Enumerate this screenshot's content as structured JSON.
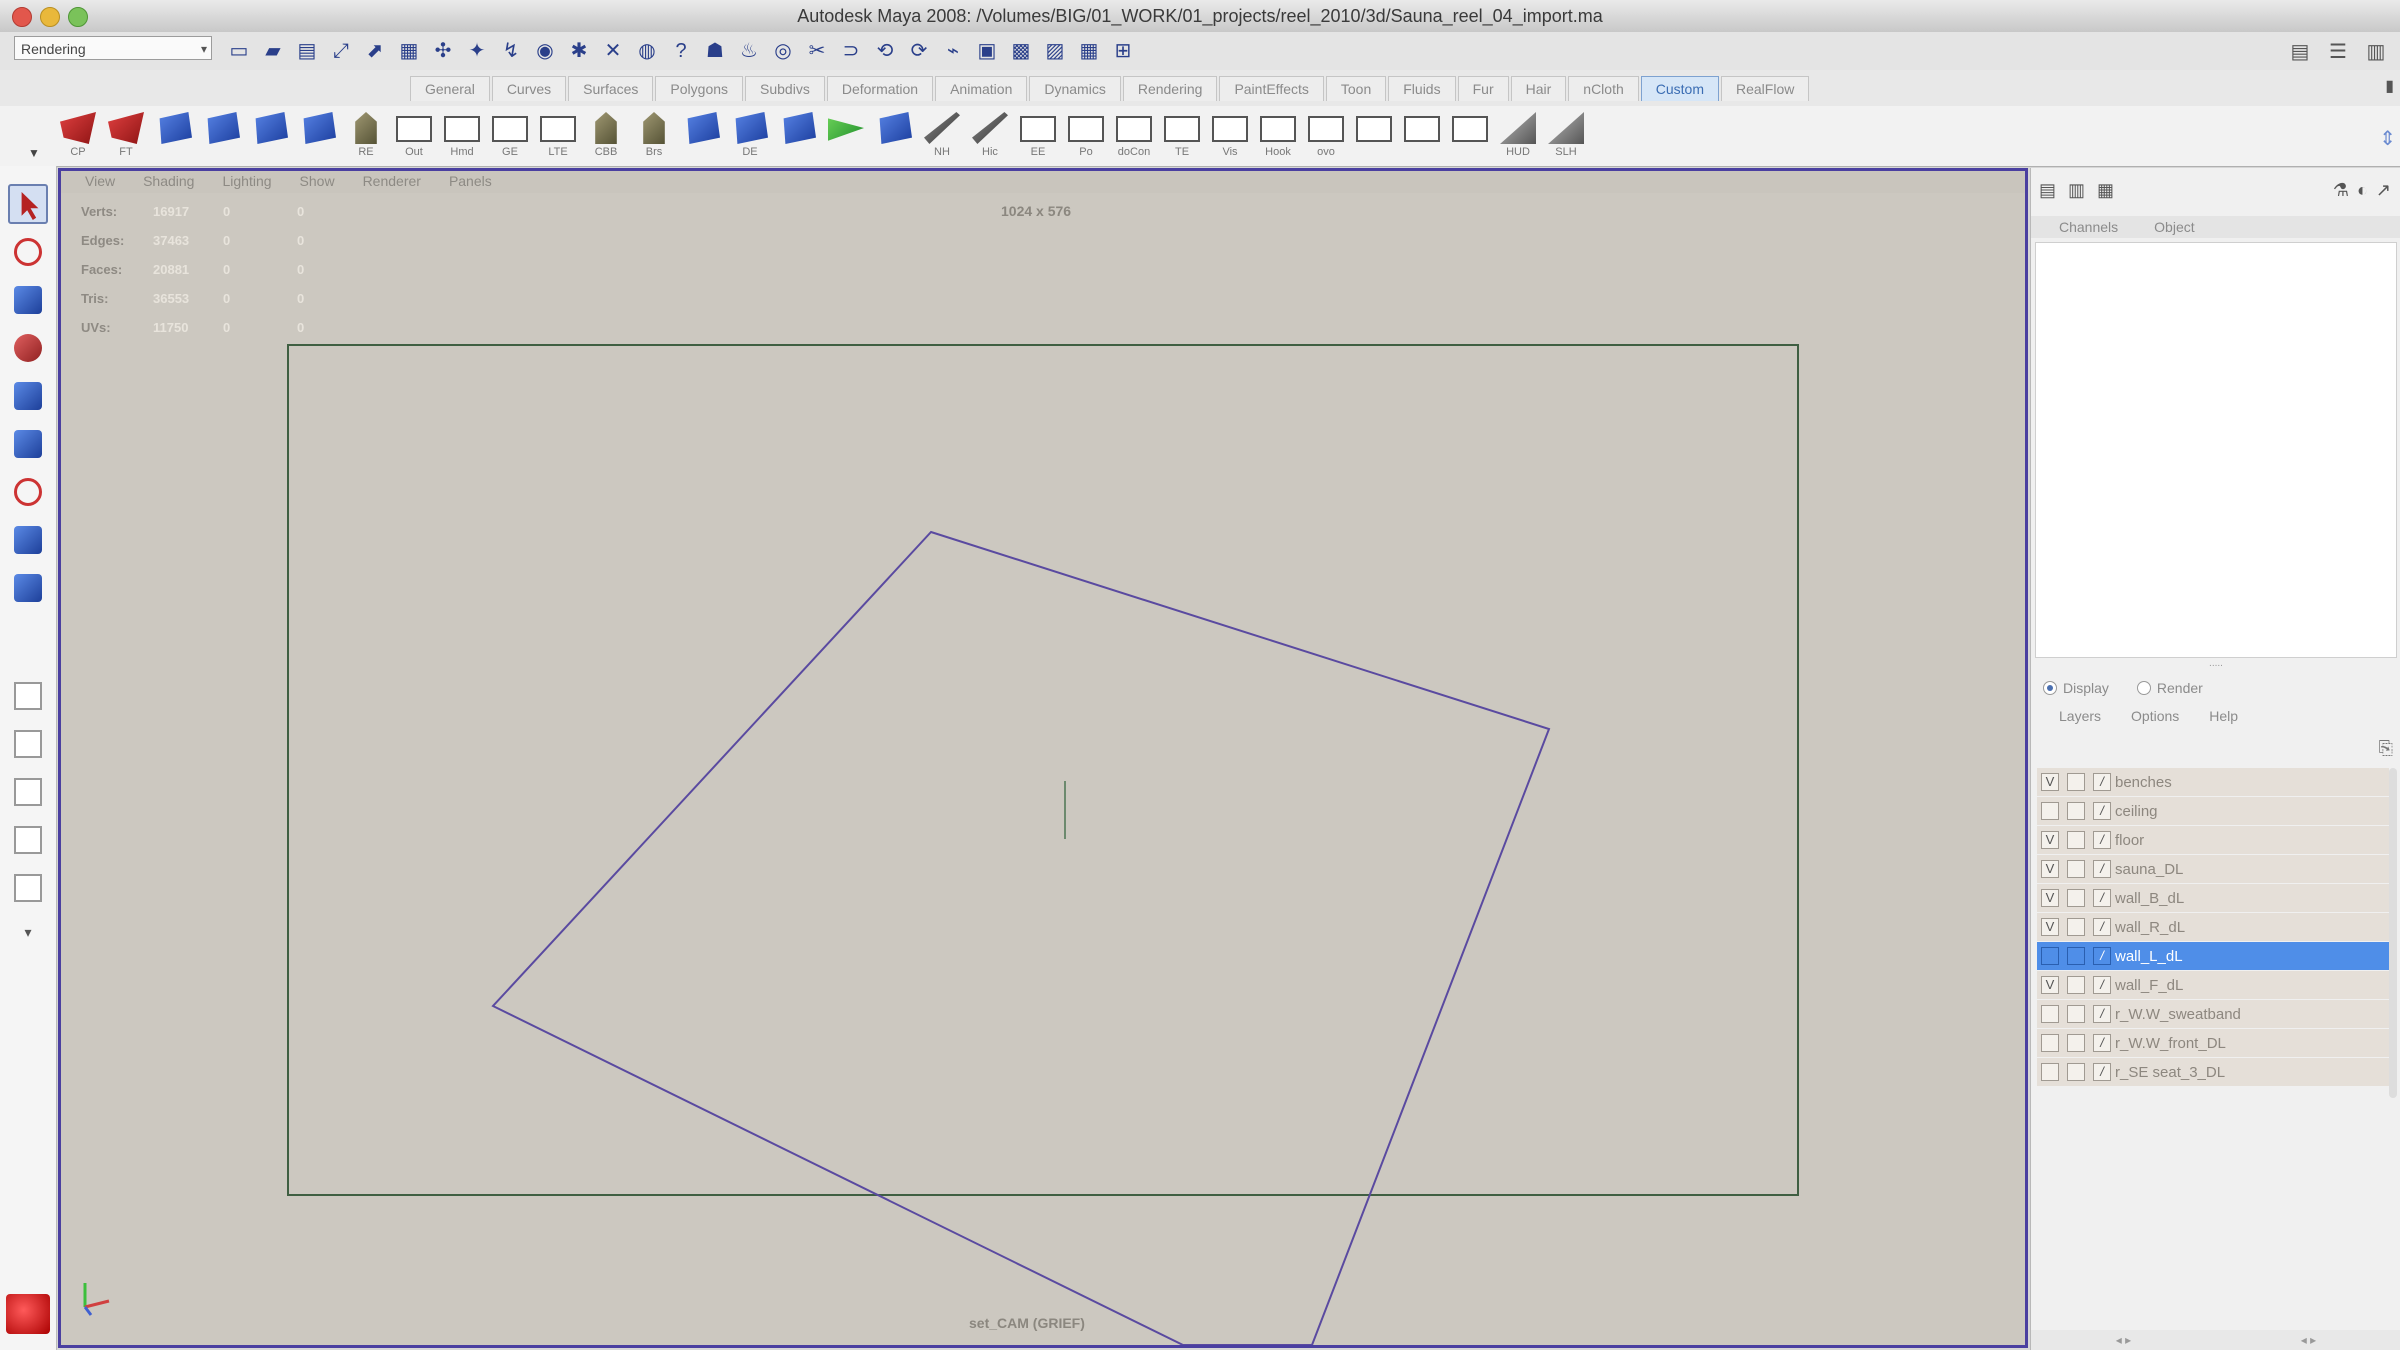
{
  "window": {
    "title": "Autodesk Maya 2008: /Volumes/BIG/01_WORK/01_projects/reel_2010/3d/Sauna_reel_04_import.ma"
  },
  "statusline": {
    "menuset": "Rendering"
  },
  "shelf_tabs": [
    "General",
    "Curves",
    "Surfaces",
    "Polygons",
    "Subdivs",
    "Deformation",
    "Animation",
    "Dynamics",
    "Rendering",
    "PaintEffects",
    "Toon",
    "Fluids",
    "Fur",
    "Hair",
    "nCloth",
    "Custom",
    "RealFlow"
  ],
  "active_shelf_tab": "Custom",
  "shelf_buttons": [
    {
      "label": "CP",
      "icon": "red"
    },
    {
      "label": "FT",
      "icon": "red"
    },
    {
      "label": "",
      "icon": "blue"
    },
    {
      "label": "",
      "icon": "blue"
    },
    {
      "label": "",
      "icon": "blue"
    },
    {
      "label": "",
      "icon": "blue"
    },
    {
      "label": "RE",
      "icon": "obj"
    },
    {
      "label": "Out",
      "icon": "box"
    },
    {
      "label": "Hmd",
      "icon": "box"
    },
    {
      "label": "GE",
      "icon": "box"
    },
    {
      "label": "LTE",
      "icon": "box"
    },
    {
      "label": "CBB",
      "icon": "obj"
    },
    {
      "label": "Brs",
      "icon": "obj"
    },
    {
      "label": "",
      "icon": "blue"
    },
    {
      "label": "DE",
      "icon": "blue"
    },
    {
      "label": "",
      "icon": "blue"
    },
    {
      "label": "",
      "icon": "green"
    },
    {
      "label": "",
      "icon": "blue"
    },
    {
      "label": "NH",
      "icon": "pen"
    },
    {
      "label": "Hic",
      "icon": "pen"
    },
    {
      "label": "EE",
      "icon": "box"
    },
    {
      "label": "Po",
      "icon": "box"
    },
    {
      "label": "doCon",
      "icon": "box"
    },
    {
      "label": "TE",
      "icon": "box"
    },
    {
      "label": "Vis",
      "icon": "box"
    },
    {
      "label": "Hook",
      "icon": "box"
    },
    {
      "label": "ovo",
      "icon": "box"
    },
    {
      "label": "",
      "icon": "box"
    },
    {
      "label": "",
      "icon": "box"
    },
    {
      "label": "",
      "icon": "box"
    },
    {
      "label": "HUD",
      "icon": "tri"
    },
    {
      "label": "SLH",
      "icon": "tri"
    }
  ],
  "viewport": {
    "menu": [
      "View",
      "Shading",
      "Lighting",
      "Show",
      "Renderer",
      "Panels"
    ],
    "hud": [
      {
        "label": "Verts:",
        "a": "16917",
        "b": "0",
        "c": "0"
      },
      {
        "label": "Edges:",
        "a": "37463",
        "b": "0",
        "c": "0"
      },
      {
        "label": "Faces:",
        "a": "20881",
        "b": "0",
        "c": "0"
      },
      {
        "label": "Tris:",
        "a": "36553",
        "b": "0",
        "c": "0"
      },
      {
        "label": "UVs:",
        "a": "11750",
        "b": "0",
        "c": "0"
      }
    ],
    "resolution": "1024 x 576",
    "camera": "set_CAM (GRIEF)"
  },
  "channel_box": {
    "tabs": [
      "Channels",
      "Object"
    ]
  },
  "layer_editor": {
    "modes": [
      {
        "label": "Display",
        "selected": true
      },
      {
        "label": "Render",
        "selected": false
      }
    ],
    "menu": [
      "Layers",
      "Options",
      "Help"
    ],
    "layers": [
      {
        "name": "benches",
        "visible": "V",
        "selected": false
      },
      {
        "name": "ceiling",
        "visible": "",
        "selected": false
      },
      {
        "name": "floor",
        "visible": "V",
        "selected": false
      },
      {
        "name": "sauna_DL",
        "visible": "V",
        "selected": false
      },
      {
        "name": "wall_B_dL",
        "visible": "V",
        "selected": false
      },
      {
        "name": "wall_R_dL",
        "visible": "V",
        "selected": false
      },
      {
        "name": "wall_L_dL",
        "visible": "",
        "selected": true
      },
      {
        "name": "wall_F_dL",
        "visible": "V",
        "selected": false
      },
      {
        "name": "r_W.W_sweatband",
        "visible": "",
        "selected": false
      },
      {
        "name": "r_W.W_front_DL",
        "visible": "",
        "selected": false
      },
      {
        "name": "r_SE seat_3_DL",
        "visible": "",
        "selected": false
      }
    ]
  },
  "colors": {
    "viewport_bg": "#ccc8c0",
    "active_panel_border": "#4a3fa0",
    "selected_layer": "#4f8ee8",
    "wireframe": "#5a4aa0"
  }
}
